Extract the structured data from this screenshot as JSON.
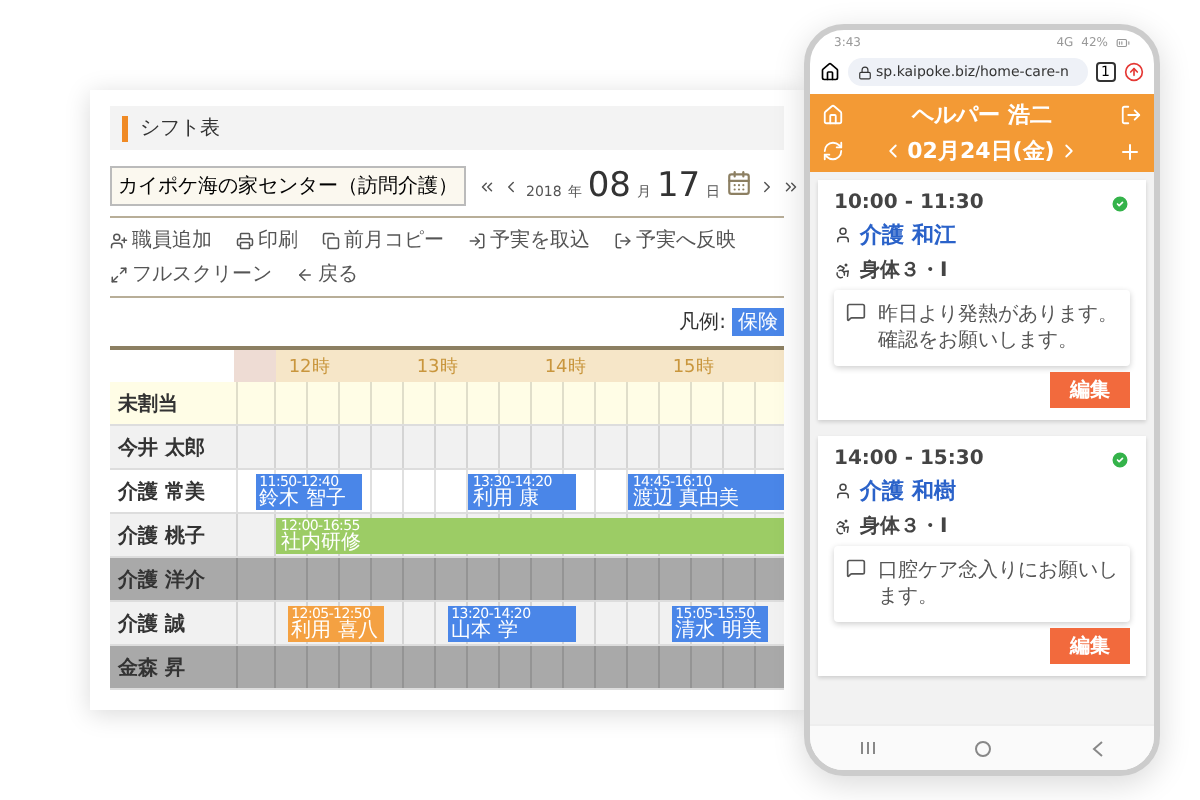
{
  "shift_table": {
    "title": "シフト表",
    "office": "カイポケ海の家センター（訪問介護）",
    "date": {
      "year": "2018",
      "year_unit": "年",
      "month": "08",
      "month_unit": "月",
      "day": "17",
      "day_unit": "日"
    },
    "toolbar": [
      {
        "kind": "add-staff",
        "label": "職員追加"
      },
      {
        "kind": "print",
        "label": "印刷"
      },
      {
        "kind": "copy",
        "label": "前月コピー"
      },
      {
        "kind": "import",
        "label": "予実を取込"
      },
      {
        "kind": "export",
        "label": "予実へ反映"
      },
      {
        "kind": "fullscreen",
        "label": "フルスクリーン"
      },
      {
        "kind": "back",
        "label": "戻る"
      }
    ],
    "legend": {
      "label": "凡例:",
      "badge": "保険"
    },
    "hours": [
      "12時",
      "13時",
      "14時",
      "15時"
    ],
    "rows": [
      {
        "name": "未割当",
        "kind": "unassigned",
        "shifts": []
      },
      {
        "name": "今井 太郎",
        "kind": "available",
        "shifts": []
      },
      {
        "name": "介護 常美",
        "kind": "working",
        "shifts": [
          {
            "time": "11:50-12:40",
            "label": "鈴木 智子",
            "color": "#4a86e8"
          },
          {
            "time": "13:30-14:20",
            "label": "利用 康",
            "color": "#4a86e8"
          },
          {
            "time": "14:45-16:10",
            "label": "渡辺 真由美",
            "color": "#4a86e8"
          }
        ]
      },
      {
        "name": "介護 桃子",
        "kind": "available",
        "shifts": [
          {
            "time": "12:00-16:55",
            "label": "社内研修",
            "color": "#9ccc65"
          }
        ]
      },
      {
        "name": "介護 洋介",
        "kind": "off",
        "shifts": []
      },
      {
        "name": "介護 誠",
        "kind": "available",
        "shifts": [
          {
            "time": "12:05-12:50",
            "label": "利用 喜八",
            "color": "#f4a142"
          },
          {
            "time": "13:20-14:20",
            "label": "山本 学",
            "color": "#4a86e8"
          },
          {
            "time": "15:05-15:50",
            "label": "清水 明美",
            "color": "#4a86e8"
          }
        ]
      },
      {
        "name": "金森 昇",
        "kind": "off",
        "shifts": []
      }
    ]
  },
  "phone": {
    "status": {
      "time": "3:43",
      "network": "4G",
      "battery": "42%"
    },
    "url": "sp.kaipoke.biz/home-care-n",
    "tab_count": "1",
    "header": {
      "title": "ヘルパー 浩二",
      "date": "02月24日(金)"
    },
    "visits": [
      {
        "time": "10:00 - 11:30",
        "client": "介護 和江",
        "service": "身体３・I",
        "note": "昨日より発熱があります。確認をお願いします。",
        "done": true,
        "button": "編集"
      },
      {
        "time": "14:00 - 15:30",
        "client": "介護 和樹",
        "service": "身体３・I",
        "note": "口腔ケア念入りにお願いします。",
        "done": true,
        "button": "編集"
      }
    ]
  }
}
